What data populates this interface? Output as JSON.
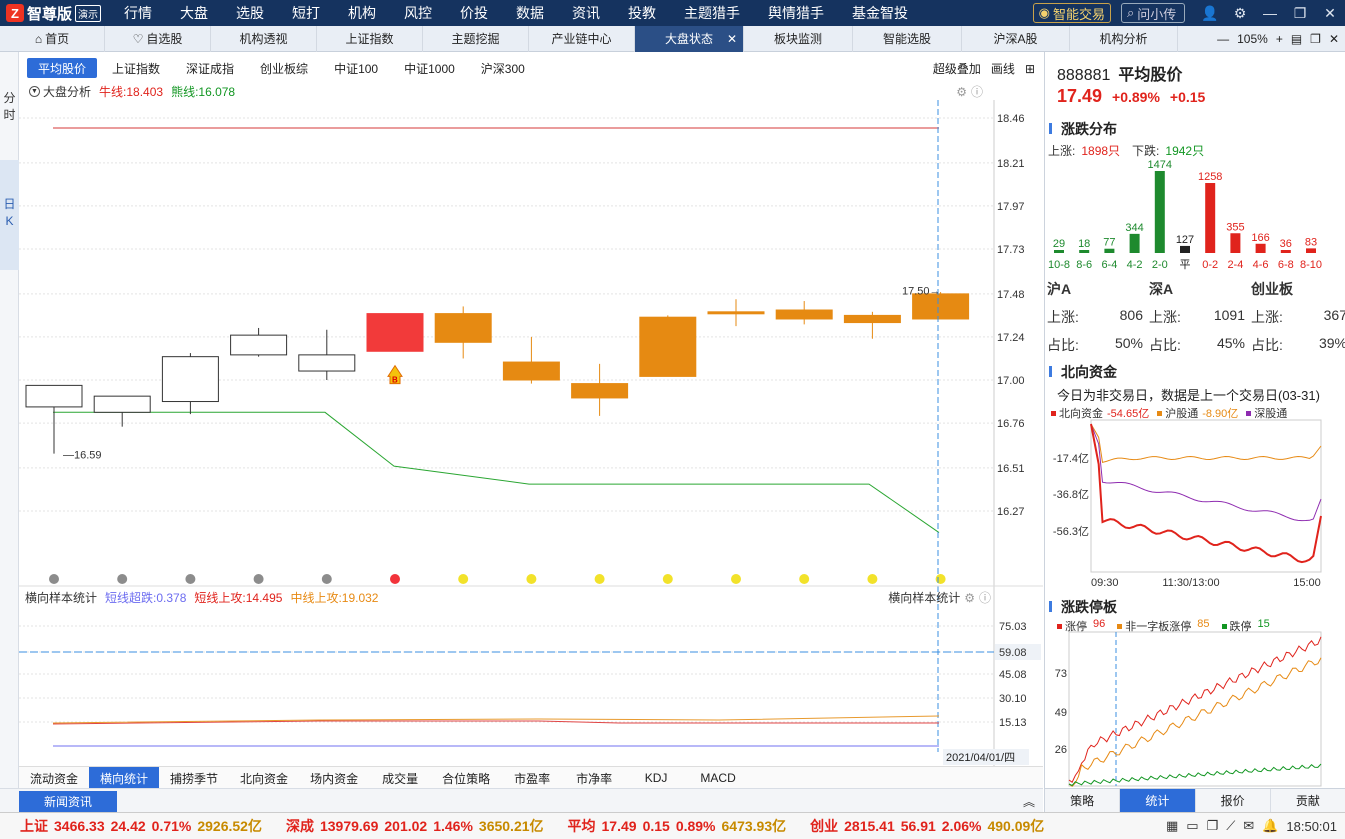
{
  "app": {
    "logo": "智尊版",
    "demo": "演示",
    "menu": [
      "行情",
      "大盘",
      "选股",
      "短打",
      "机构",
      "风控",
      "价投",
      "数据",
      "资讯",
      "投教",
      "主题猎手",
      "舆情猎手",
      "基金智投"
    ],
    "smart_trade": "智能交易",
    "ask": "问小传"
  },
  "tabs": [
    {
      "label": "首页",
      "icon": "home-icon"
    },
    {
      "label": "自选股",
      "icon": "heart-icon"
    },
    {
      "label": "机构透视"
    },
    {
      "label": "上证指数"
    },
    {
      "label": "主题挖掘"
    },
    {
      "label": "产业链中心"
    },
    {
      "label": "大盘状态",
      "active": true
    },
    {
      "label": "板块监测"
    },
    {
      "label": "智能选股"
    },
    {
      "label": "沪深A股"
    },
    {
      "label": "机构分析"
    }
  ],
  "zoom": "105%",
  "left_strip": {
    "fenshi": [
      "分",
      "时"
    ],
    "rik": [
      "日",
      "K"
    ]
  },
  "index_tabs": [
    "平均股价",
    "上证指数",
    "深证成指",
    "创业板综",
    "中证100",
    "中证1000",
    "沪深300"
  ],
  "right_tools": {
    "overlay": "超级叠加",
    "draw": "画线"
  },
  "main_legend": {
    "label": "大盘分析",
    "bull": "牛线:18.403",
    "bear": "熊线:16.078"
  },
  "sub_legend": {
    "label": "横向样本统计",
    "s1": "短线超跌:0.378",
    "s2": "短线上攻:14.495",
    "s3": "中线上攻:19.032",
    "right": "横向样本统计"
  },
  "chart_data": {
    "type": "candlestick",
    "y_ticks": [
      "18.46",
      "18.21",
      "17.97",
      "17.73",
      "17.48",
      "17.24",
      "17.00",
      "16.76",
      "16.51",
      "16.27"
    ],
    "candles": [
      {
        "o": 16.85,
        "c": 16.97,
        "h": 16.97,
        "l": 16.59,
        "color": "hollow"
      },
      {
        "o": 16.82,
        "c": 16.91,
        "h": 16.91,
        "l": 16.74,
        "color": "hollow"
      },
      {
        "o": 16.88,
        "c": 17.13,
        "h": 17.15,
        "l": 16.81,
        "color": "hollow"
      },
      {
        "o": 17.14,
        "c": 17.25,
        "h": 17.29,
        "l": 17.13,
        "color": "hollow"
      },
      {
        "o": 17.05,
        "c": 17.14,
        "h": 17.28,
        "l": 17.0,
        "color": "hollow"
      },
      {
        "o": 17.16,
        "c": 17.37,
        "h": 17.37,
        "l": 17.16,
        "color": "red"
      },
      {
        "o": 17.37,
        "c": 17.21,
        "h": 17.41,
        "l": 17.12,
        "color": "orange"
      },
      {
        "o": 17.1,
        "c": 17.0,
        "h": 17.24,
        "l": 16.98,
        "color": "orange"
      },
      {
        "o": 16.98,
        "c": 16.9,
        "h": 17.09,
        "l": 16.8,
        "color": "orange"
      },
      {
        "o": 17.35,
        "c": 17.02,
        "h": 17.36,
        "l": 17.02,
        "color": "orange"
      },
      {
        "o": 17.38,
        "c": 17.37,
        "h": 17.45,
        "l": 17.3,
        "color": "orange"
      },
      {
        "o": 17.39,
        "c": 17.34,
        "h": 17.44,
        "l": 17.31,
        "color": "orange"
      },
      {
        "o": 17.36,
        "c": 17.32,
        "h": 17.38,
        "l": 17.23,
        "color": "orange"
      },
      {
        "o": 17.48,
        "c": 17.34,
        "h": 17.49,
        "l": 17.34,
        "color": "orange"
      }
    ],
    "bull_line": 18.403,
    "bear_line": [
      16.82,
      16.82,
      16.82,
      16.82,
      16.82,
      16.52,
      null,
      16.42,
      null,
      null,
      null,
      null,
      16.42,
      16.15
    ],
    "low_label": "16.59",
    "last_label": "17.50",
    "signals": [
      "gray",
      "gray",
      "gray",
      "gray",
      "gray",
      "red",
      "yellow",
      "yellow",
      "yellow",
      "yellow",
      "yellow",
      "yellow",
      "yellow",
      "yellow"
    ],
    "buy_mark": "B",
    "sub_ticks": [
      "75.03",
      "59.08",
      "45.08",
      "30.10",
      "15.13"
    ],
    "date": "2021/04/01/四"
  },
  "bottom_tabs": [
    "流动资金",
    "横向统计",
    "捕捞季节",
    "北向资金",
    "场内资金",
    "成交量",
    "合位策略",
    "市盈率",
    "市净率",
    "KDJ",
    "MACD"
  ],
  "news": "新闻资讯",
  "right": {
    "code": "888881",
    "name": "平均股价",
    "price": "17.49",
    "chg_pct": "+0.89%",
    "chg": "+0.15",
    "dist_title": "涨跌分布",
    "up_label": "上涨:",
    "up_count": "1898只",
    "down_label": "下跌:",
    "down_count": "1942只",
    "dist": {
      "bins": [
        "10-8",
        "8-6",
        "6-4",
        "4-2",
        "2-0",
        "平",
        "0-2",
        "2-4",
        "4-6",
        "6-8",
        "8-10"
      ],
      "values": [
        29,
        18,
        77,
        344,
        1474,
        127,
        1258,
        355,
        166,
        36,
        83
      ]
    },
    "markets": [
      {
        "name": "沪A",
        "up": "806",
        "ratio": "50%"
      },
      {
        "name": "深A",
        "up": "1091",
        "ratio": "45%"
      },
      {
        "name": "创业板",
        "up": "367",
        "ratio": "39%"
      }
    ],
    "mk_up": "上涨:",
    "mk_ratio": "占比:",
    "north_title": "北向资金",
    "north_note": "今日为非交易日，数据是上一个交易日(03-31)",
    "north_legend": [
      {
        "name": "北向资金",
        "value": "-54.65亿"
      },
      {
        "name": "沪股通",
        "value": "-8.90亿"
      },
      {
        "name": "深股通",
        "value": ""
      }
    ],
    "north_ticks": [
      "-17.4亿",
      "-36.8亿",
      "-56.3亿"
    ],
    "north_x": [
      "09:30",
      "11:30/13:00",
      "15:00"
    ],
    "limit_title": "涨跌停板",
    "limit_legend": [
      {
        "name": "涨停",
        "value": "96"
      },
      {
        "name": "非一字板涨停",
        "value": "85"
      },
      {
        "name": "跌停",
        "value": "15"
      }
    ],
    "limit_ticks": [
      "73",
      "49",
      "26"
    ],
    "btabs": [
      "策略",
      "统计",
      "报价",
      "贡献"
    ]
  },
  "status": [
    {
      "name": "上证",
      "v": "3466.33",
      "c": "24.42",
      "p": "0.71%",
      "a": "2926.52亿"
    },
    {
      "name": "深成",
      "v": "13979.69",
      "c": "201.02",
      "p": "1.46%",
      "a": "3650.21亿"
    },
    {
      "name": "平均",
      "v": "17.49",
      "c": "0.15",
      "p": "0.89%",
      "a": "6473.93亿"
    },
    {
      "name": "创业",
      "v": "2815.41",
      "c": "56.91",
      "p": "2.06%",
      "a": "490.09亿"
    }
  ],
  "time": "18:50:01"
}
